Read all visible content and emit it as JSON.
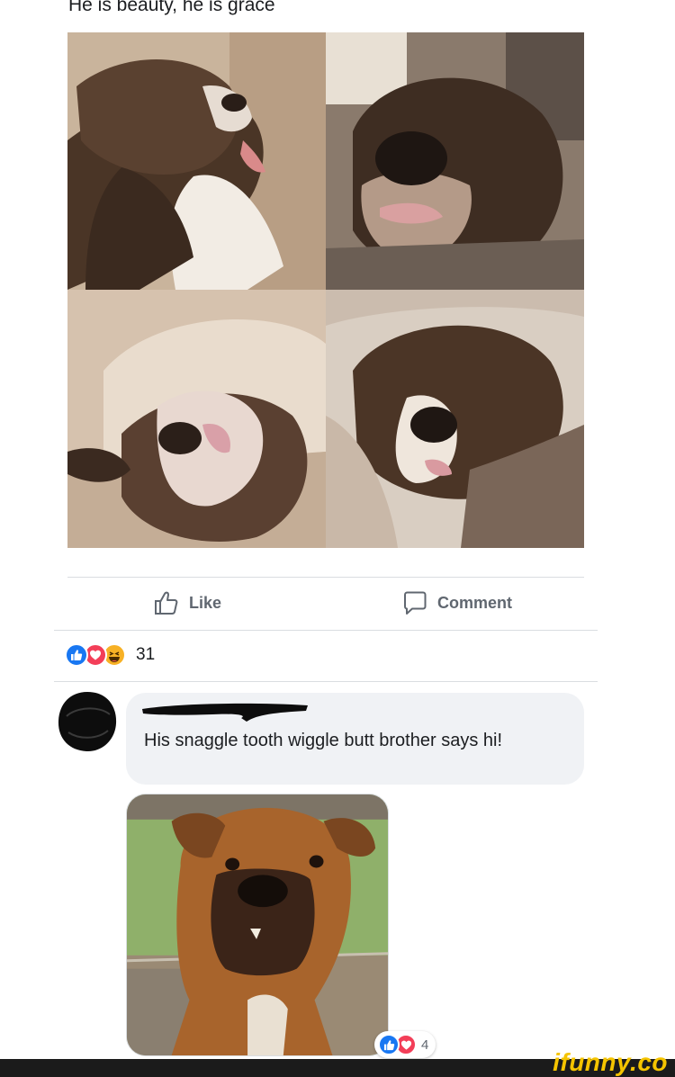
{
  "post": {
    "caption": "He is beauty, he is grace",
    "photos": [
      {
        "icon": "sleeping-dog-photo",
        "description_tag": "dog-sleeping-on-couch"
      },
      {
        "icon": "sleeping-dog-photo",
        "description_tag": "dog-face-closeup"
      },
      {
        "icon": "sleeping-dog-photo",
        "description_tag": "dog-upside-down"
      },
      {
        "icon": "sleeping-dog-photo",
        "description_tag": "dog-on-pillow"
      }
    ]
  },
  "actions": {
    "like_label": "Like",
    "comment_label": "Comment"
  },
  "reactions": {
    "icons": [
      "like-reaction-icon",
      "love-reaction-icon",
      "haha-reaction-icon"
    ],
    "count": "31"
  },
  "comment": {
    "author_name_redacted": true,
    "text": "His snaggle tooth wiggle butt brother says hi!",
    "reactions": {
      "icons": [
        "like-reaction-icon",
        "love-reaction-icon"
      ],
      "count": "4"
    }
  },
  "colors": {
    "like_blue": "#1877f2",
    "love_red": "#f33e58",
    "haha_yellow": "#f7b125",
    "bubble_bg": "#f0f2f5",
    "action_gray": "#606770",
    "watermark_yellow": "#f5c400"
  },
  "watermark": {
    "text": "ifunny.co"
  }
}
